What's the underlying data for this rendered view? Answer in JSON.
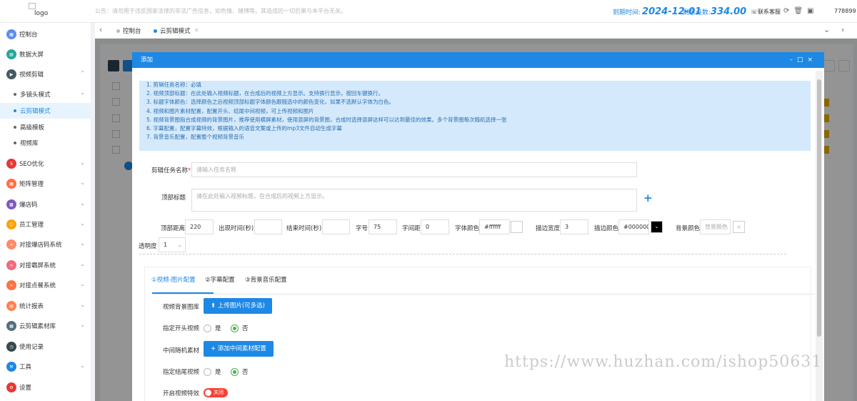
{
  "header": {
    "logo_alt": "logo",
    "notice": "公告：请勿用于违反国家法律的非法广告信息，如色情、赌博等。其造成的一切后果与本平台无关。",
    "expire_label": "到期时间:",
    "expire_value": "2024-12-01",
    "points_label": "剩余点数:",
    "points_value": "334.00",
    "service": "联系客服",
    "user": "778899"
  },
  "sidebar": {
    "items": [
      {
        "label": "控制台",
        "icon": "dashboard-icon",
        "color": "#5b8def"
      },
      {
        "label": "数据大屏",
        "icon": "screen-icon",
        "color": "#26a69a"
      },
      {
        "label": "视频剪辑",
        "icon": "video-icon",
        "color": "#455a64"
      },
      {
        "label": "SEO优化",
        "icon": "seo-icon",
        "color": "#e53935"
      },
      {
        "label": "矩阵管理",
        "icon": "matrix-icon",
        "color": "#ff7043"
      },
      {
        "label": "爆店码",
        "icon": "qrcode-icon",
        "color": "#7e57c2"
      },
      {
        "label": "员工管理",
        "icon": "staff-icon",
        "color": "#ffa000"
      },
      {
        "label": "对接爆店码系统",
        "icon": "link-icon",
        "color": "#ff8a65"
      },
      {
        "label": "对接霸屏系统",
        "icon": "link-icon",
        "color": "#ef6c7b"
      },
      {
        "label": "对接点餐系统",
        "icon": "link-icon",
        "color": "#ff7043"
      },
      {
        "label": "统计报表",
        "icon": "report-icon",
        "color": "#ff7f50"
      },
      {
        "label": "云剪辑素材库",
        "icon": "library-icon",
        "color": "#546e7a"
      },
      {
        "label": "使用记录",
        "icon": "record-icon",
        "color": "#37474f"
      },
      {
        "label": "工具",
        "icon": "tool-icon",
        "color": "#1e88e5"
      },
      {
        "label": "设置",
        "icon": "settings-icon",
        "color": "#e53935"
      }
    ],
    "subitems": [
      "多镜头模式",
      "云剪辑模式",
      "高级模板",
      "视频库"
    ]
  },
  "tabs": [
    "控制台",
    "云剪辑模式"
  ],
  "modal": {
    "title": "添加",
    "tips": [
      "1. 剪辑任务名称：必填",
      "2. 视频顶部标题：在此处输入视频标题，在合成后的视频上方显示。支持换行显示，按回车键换行。",
      "3. 标题字体颜色：选择颜色之后视频顶部标题字体颜色跟随选中的颜色变化，如果不选默认字体为白色。",
      "4. 视频和图片素材配置，配置开头、结尾中间视频，可上传视频和图片",
      "5. 视频背景图指合成视频的背景图片，推荐使用横屏素材，使用竖屏的背景图，合成时选择竖屏这样可以达到最佳的效果。多个背景图每次随机选择一张",
      "6. 字幕配置，配置字幕特效，根据输入的语音文案或上传的mp3文件自动生成字幕",
      "7. 背景音乐配置，配置整个视频背景音乐"
    ],
    "task_name_label": "剪辑任务名称",
    "task_name_placeholder": "请输入任务名称",
    "top_title_label": "顶部标题",
    "top_title_placeholder": "请在此处输入视频标题，在合成后的视频上方显示。",
    "fields": {
      "top_distance_label": "顶部距离",
      "top_distance_value": "220",
      "appear_label": "出现时间(秒)",
      "end_label": "结束时间(秒)",
      "font_size_label": "字号",
      "font_size_value": "75",
      "spacing_label": "字间距",
      "spacing_value": "0",
      "font_color_label": "字体颜色",
      "font_color_value": "#ffffff",
      "stroke_width_label": "描边宽度",
      "stroke_width_value": "3",
      "stroke_color_label": "描边颜色",
      "stroke_color_value": "#000000",
      "bg_color_label": "背景颜色",
      "bg_color_placeholder": "背景颜色",
      "opacity_label": "透明度",
      "opacity_value": "1"
    },
    "subtabs": [
      "①视频-图片配置",
      "②字幕配置",
      "③背景音乐配置"
    ],
    "bg_lib_label": "视频背景图库",
    "upload_btn": "上传图片(可多选)",
    "intro_label": "指定开头视频",
    "yes": "是",
    "no": "否",
    "mid_label": "中间随机素材",
    "add_mid_btn": "添加中间素材配置",
    "outro_label": "指定结尾视频",
    "effect_label": "开启视频特效",
    "effect_toggle": "关闭"
  },
  "watermark": "https://www.huzhan.com/ishop50631"
}
